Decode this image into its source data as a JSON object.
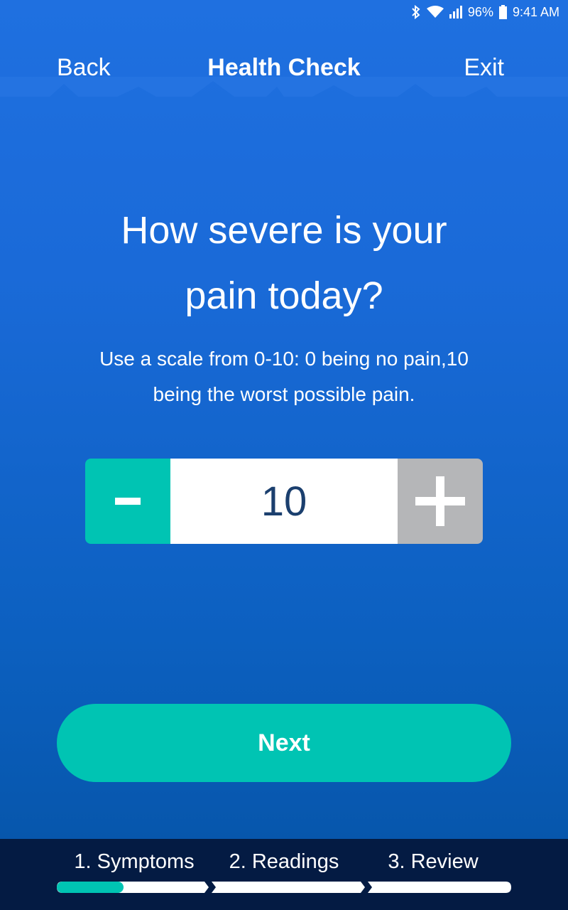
{
  "status_bar": {
    "battery": "96%",
    "time": "9:41 AM",
    "icons": [
      "bluetooth-icon",
      "wifi-icon",
      "signal-icon",
      "battery-icon"
    ]
  },
  "header": {
    "back_label": "Back",
    "title": "Health Check",
    "exit_label": "Exit"
  },
  "question": {
    "line1": "How severe is your",
    "line2": "pain today?",
    "instruction_line1": "Use a scale from 0-10: 0 being no pain,10",
    "instruction_line2": "being the worst possible pain."
  },
  "stepper": {
    "value": "10",
    "minus_icon": "minus-icon",
    "plus_icon": "plus-icon"
  },
  "next_label": "Next",
  "steps": [
    {
      "label": "1. Symptoms"
    },
    {
      "label": "2. Readings"
    },
    {
      "label": "3. Review"
    }
  ],
  "progress": {
    "current_step": 1,
    "step_fraction": 0.45
  },
  "colors": {
    "accent": "#00c4b3",
    "background_top": "#1f70e0",
    "background_bottom": "#0553a5",
    "footer": "#041b43",
    "value_text": "#1b3f6e",
    "disabled": "#b5b6b8"
  }
}
